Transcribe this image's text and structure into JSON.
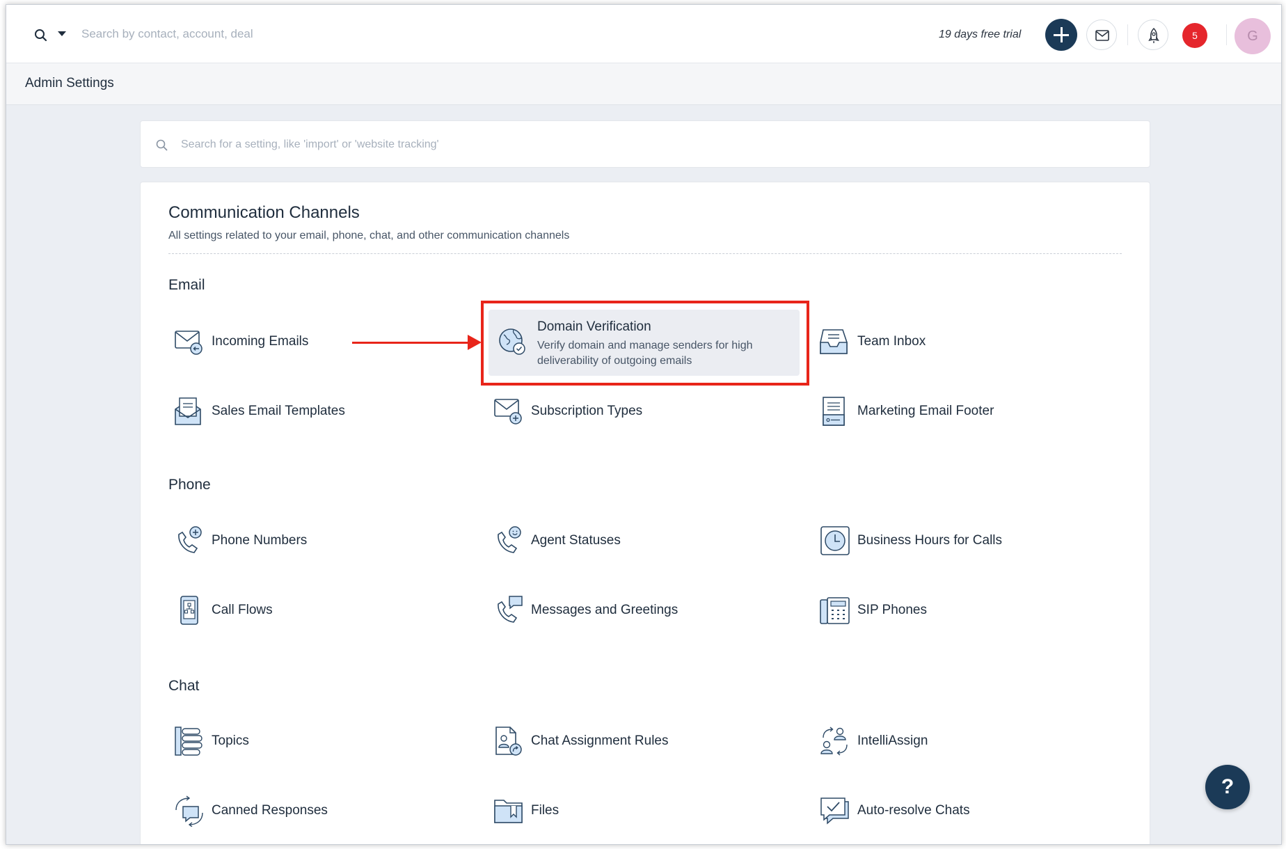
{
  "topbar": {
    "search_placeholder": "Search by contact, account, deal",
    "trial_text": "19 days free trial",
    "notification_count": "5",
    "avatar_initial": "G"
  },
  "admin": {
    "title": "Admin Settings"
  },
  "settings_search": {
    "placeholder": "Search for a setting, like 'import' or 'website tracking'"
  },
  "card": {
    "title": "Communication Channels",
    "subtitle": "All settings related to your email, phone, chat, and other communication channels"
  },
  "sections": {
    "email": {
      "title": "Email",
      "items": [
        {
          "label": "Incoming Emails",
          "icon": "incoming-email-icon"
        },
        {
          "label": "Domain Verification",
          "description": "Verify domain and manage senders for high deliverability of outgoing emails",
          "icon": "globe-check-icon"
        },
        {
          "label": "Team Inbox",
          "icon": "inbox-tray-icon"
        },
        {
          "label": "Sales Email Templates",
          "icon": "email-template-icon"
        },
        {
          "label": "Subscription Types",
          "icon": "email-plus-icon"
        },
        {
          "label": "Marketing Email Footer",
          "icon": "document-footer-icon"
        }
      ]
    },
    "phone": {
      "title": "Phone",
      "items": [
        {
          "label": "Phone Numbers",
          "icon": "phone-plus-icon"
        },
        {
          "label": "Agent Statuses",
          "icon": "phone-smiley-icon"
        },
        {
          "label": "Business Hours for Calls",
          "icon": "clock-icon"
        },
        {
          "label": "Call Flows",
          "icon": "call-flow-icon"
        },
        {
          "label": "Messages and Greetings",
          "icon": "phone-message-icon"
        },
        {
          "label": "SIP Phones",
          "icon": "desk-phone-icon"
        }
      ]
    },
    "chat": {
      "title": "Chat",
      "items": [
        {
          "label": "Topics",
          "icon": "topics-icon"
        },
        {
          "label": "Chat Assignment Rules",
          "icon": "assignment-rules-icon"
        },
        {
          "label": "IntelliAssign",
          "icon": "intelliassign-icon"
        },
        {
          "label": "Canned Responses",
          "icon": "canned-responses-icon"
        },
        {
          "label": "Files",
          "icon": "folder-icon"
        },
        {
          "label": "Auto-resolve Chats",
          "icon": "chat-check-icon"
        }
      ]
    }
  },
  "help_label": "?",
  "colors": {
    "accent_dark": "#1b3a57",
    "highlight_red": "#e8251a",
    "badge_red": "#e5262c",
    "icon_fill": "#cfe3f7",
    "icon_stroke": "#2e4a66"
  }
}
